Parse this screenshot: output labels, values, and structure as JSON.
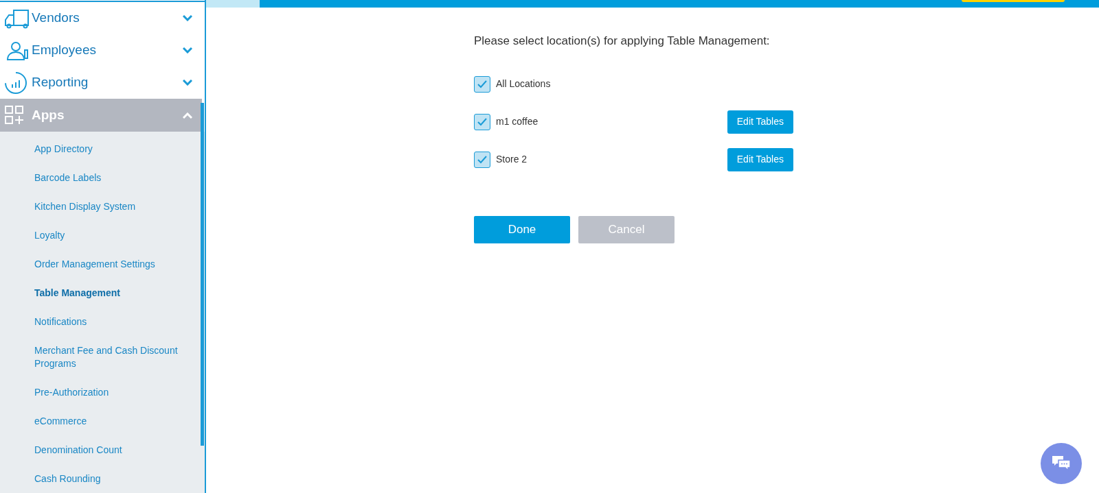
{
  "nav": [
    {
      "label": "Vendors",
      "kind": "truck",
      "expanded": false
    },
    {
      "label": "Employees",
      "kind": "person",
      "expanded": false
    },
    {
      "label": "Reporting",
      "kind": "chart",
      "expanded": false
    },
    {
      "label": "Apps",
      "kind": "apps",
      "expanded": true
    }
  ],
  "subnav": [
    {
      "label": "App Directory",
      "selected": false
    },
    {
      "label": "Barcode Labels",
      "selected": false
    },
    {
      "label": "Kitchen Display System",
      "selected": false
    },
    {
      "label": "Loyalty",
      "selected": false
    },
    {
      "label": "Order Management Settings",
      "selected": false
    },
    {
      "label": "Table Management",
      "selected": true
    },
    {
      "label": "Notifications",
      "selected": false
    },
    {
      "label": "Merchant Fee and Cash Discount Programs",
      "selected": false
    },
    {
      "label": "Pre-Authorization",
      "selected": false
    },
    {
      "label": "eCommerce",
      "selected": false
    },
    {
      "label": "Denomination Count",
      "selected": false
    },
    {
      "label": "Cash Rounding",
      "selected": false
    }
  ],
  "prompt": "Please select location(s) for applying Table Management:",
  "locations": [
    {
      "label": "All Locations",
      "checked": true
    },
    {
      "label": "m1 coffee",
      "checked": true,
      "action": "Edit Tables"
    },
    {
      "label": "Store 2",
      "checked": true,
      "action": "Edit Tables"
    }
  ],
  "buttons": [
    {
      "label": "Done",
      "disabled": false
    },
    {
      "label": "Cancel",
      "disabled": true
    }
  ]
}
